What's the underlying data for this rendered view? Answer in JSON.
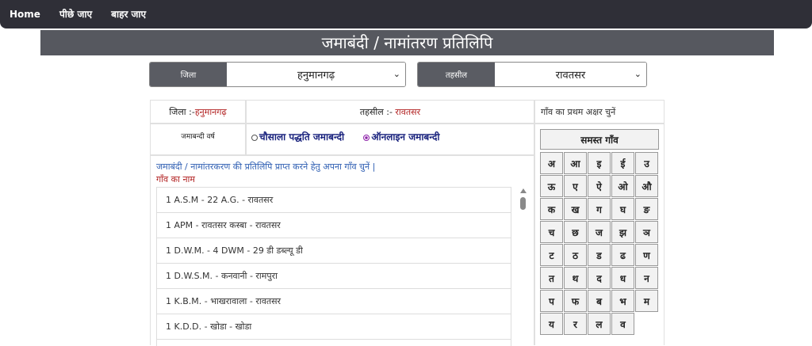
{
  "nav": {
    "home": "Home",
    "back": "पीछे जाए",
    "exit": "बाहर जाए"
  },
  "page_title": "जमाबंदी / नामांतरण प्रतिलिपि",
  "district_select": {
    "label": "जिला",
    "value": "हनुमानगढ़"
  },
  "tehsil_select": {
    "label": "तहसील",
    "value": "रावतसर"
  },
  "info": {
    "district_prefix": "जिला :-",
    "district_value": "हनुमानगढ़",
    "tehsil_prefix": "तहसील :-",
    "tehsil_value": "रावतसर",
    "letter_heading": "गाँव का प्रथम अक्षर चुनें"
  },
  "jamabandi_year": {
    "label": "जमाबन्दी वर्ष",
    "option1": "चौसाला पद्धति जमाबन्दी",
    "option2": "ऑनलाइन जमाबन्दी",
    "selected": "option2"
  },
  "instruction": "जमाबंदी / नामांतरकरण की प्रतिलिपि प्राप्त करने हेतु अपना गाँव चुनें |",
  "village_name_label": "गाँव का नाम",
  "villages": [
    "1 A.S.M - 22 A.G. - रावतसर",
    "1 APM - रावतसर कस्बा - रावतसर",
    "1 D.W.M. - 4 DWM - 29 डी डब्ल्यू डी",
    "1 D.W.S.M. - कनवानी - रामपुरा",
    "1 K.B.M. - भाखरावाला - रावतसर",
    "1 K.D.D. - खोडा - खोडा"
  ],
  "all_villages_button": "समस्त गाँव",
  "letters": [
    "अ",
    "आ",
    "इ",
    "ई",
    "उ",
    "ऊ",
    "ए",
    "ऐ",
    "ओ",
    "औ",
    "क",
    "ख",
    "ग",
    "घ",
    "ङ",
    "च",
    "छ",
    "ज",
    "झ",
    "ञ",
    "ट",
    "ठ",
    "ड",
    "ढ",
    "ण",
    "त",
    "थ",
    "द",
    "ध",
    "न",
    "प",
    "फ",
    "ब",
    "भ",
    "म",
    "य",
    "र",
    "ल",
    "व"
  ]
}
